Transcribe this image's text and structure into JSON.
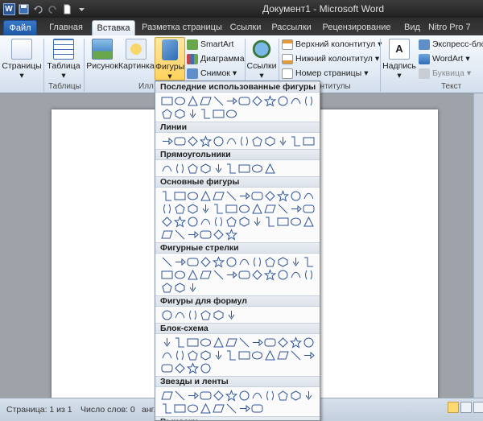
{
  "window": {
    "title": "Документ1 - Microsoft Word",
    "app_icon": "W"
  },
  "tabs": [
    {
      "label": "Файл",
      "state": "file"
    },
    {
      "label": "Главная",
      "state": "normal"
    },
    {
      "label": "Вставка",
      "state": "active"
    },
    {
      "label": "Разметка страницы",
      "state": "normal"
    },
    {
      "label": "Ссылки",
      "state": "normal"
    },
    {
      "label": "Рассылки",
      "state": "normal"
    },
    {
      "label": "Рецензирование",
      "state": "normal"
    },
    {
      "label": "Вид",
      "state": "normal"
    },
    {
      "label": "Nitro Pro 7",
      "state": "normal"
    }
  ],
  "ribbon": {
    "pages_label": "Страницы",
    "table_label": "Таблица",
    "tables_group": "Таблицы",
    "picture_label": "Рисунок",
    "clipart_label": "Картинка",
    "shapes_label": "Фигуры",
    "illustrations_group": "Илл",
    "smartart_label": "SmartArt",
    "chart_label": "Диаграмма",
    "screenshot_label": "Снимок",
    "links_label": "Ссылки",
    "header_label": "Верхний колонтитул",
    "footer_label": "Нижний колонтитул",
    "pagenum_label": "Номер страницы",
    "headerfooter_group": "онтитулы",
    "textbox_label": "Надпись",
    "quickparts_label": "Экспресс-блок",
    "wordart_label": "WordArt",
    "dropcap_label": "Буквица",
    "text_group": "Текст"
  },
  "gallery": {
    "sections": [
      {
        "title": "Последние использованные фигуры",
        "count": 18
      },
      {
        "title": "Линии",
        "count": 12
      },
      {
        "title": "Прямоугольники",
        "count": 9
      },
      {
        "title": "Основные фигуры",
        "count": 42
      },
      {
        "title": "Фигурные стрелки",
        "count": 27
      },
      {
        "title": "Фигуры для формул",
        "count": 6
      },
      {
        "title": "Блок-схема",
        "count": 28
      },
      {
        "title": "Звезды и ленты",
        "count": 20
      },
      {
        "title": "Выноски",
        "count": 0
      }
    ]
  },
  "status": {
    "page": "Страница: 1 из 1",
    "words": "Число слов: 0",
    "lang": "англ"
  },
  "colors": {
    "shape_stroke": "#2f5597",
    "file_tab": "#2b63b5",
    "active_button": "#ffd25c"
  }
}
